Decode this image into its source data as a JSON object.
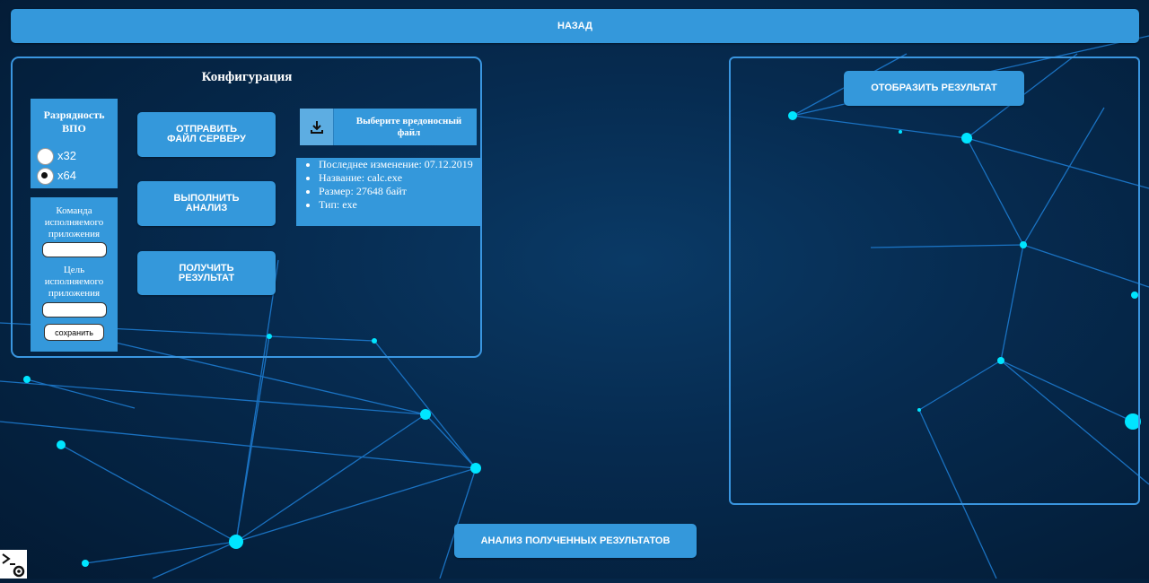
{
  "header": {
    "back_label": "НАЗАД"
  },
  "config": {
    "title": "Конфигурация",
    "bitness": {
      "label": "Разрядность ВПО",
      "options": [
        {
          "label": "x32",
          "selected": false
        },
        {
          "label": "x64",
          "selected": true
        }
      ]
    },
    "command": {
      "label": "Команда исполняемого приложения",
      "value": ""
    },
    "target": {
      "label": "Цель исполняемого приложения",
      "value": ""
    },
    "save_label": "сохранить",
    "send_label": "ОТПРАВИТЬ ФАЙЛ СЕРВЕРУ",
    "analyze_label": "ВЫПОЛНИТЬ АНАЛИЗ",
    "get_result_label": "ПОЛУЧИТЬ РЕЗУЛЬТАТ",
    "file_select_label": "Выберите вредоносный файл",
    "file_info": [
      "Последнее изменение: 07.12.2019",
      "Название: calc.exe",
      "Размер: 27648 байт",
      "Тип: exe"
    ]
  },
  "result_panel": {
    "show_label": "ОТОБРАЗИТЬ РЕЗУЛЬТАТ"
  },
  "footer": {
    "analysis_label": "АНАЛИЗ ПОЛУЧЕННЫХ РЕЗУЛЬТАТОВ"
  },
  "icons": {
    "download": "download-icon",
    "terminal": "terminal-settings-icon"
  },
  "colors": {
    "accent": "#3498db",
    "panel_border": "#3a96e0",
    "background": "#062b50"
  }
}
